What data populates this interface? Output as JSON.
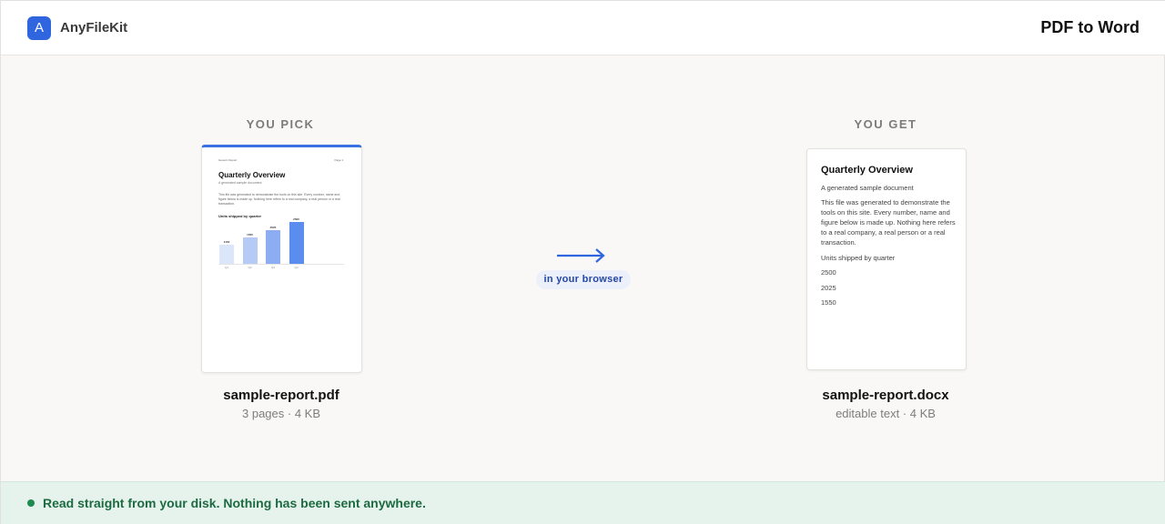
{
  "app": {
    "logo_letter": "A",
    "name": "AnyFileKit",
    "tool_title": "PDF to Word"
  },
  "source": {
    "label": "YOU PICK",
    "file_name": "sample-report.pdf",
    "meta": "3 pages · 4 KB",
    "preview": {
      "header_left": "Generic Report",
      "header_right": "Page 1",
      "title": "Quarterly Overview",
      "subtitle": "A generated sample document",
      "body": "This file was generated to demonstrate the tools on this site. Every number, name and figure below is made up. Nothing here refers to a real company, a real person or a real transaction.",
      "chart_title": "Units shipped by quarter",
      "chart_data": {
        "type": "bar",
        "categories": [
          "Q1",
          "Q2",
          "Q3",
          "Q4"
        ],
        "values": [
          1150,
          1550,
          2025,
          2500
        ]
      }
    }
  },
  "connector": {
    "label": "in your browser"
  },
  "result": {
    "label": "YOU GET",
    "file_name": "sample-report.docx",
    "meta": "editable text · 4 KB",
    "preview": {
      "title": "Quarterly Overview",
      "lines": [
        "A generated sample document",
        "This file was generated to demonstrate the tools on this site. Every number, name and figure below is made up. Nothing here refers to a real company, a real person or a real transaction.",
        "Units shipped by quarter",
        "2500",
        "2025",
        "1550"
      ]
    }
  },
  "footer": {
    "message": "Read straight from your disk. Nothing has been sent anywhere."
  },
  "colors": {
    "accent": "#2f66e0",
    "success": "#1f8a52",
    "bar_colors": [
      "#dce6fb",
      "#b5cbf6",
      "#8cadf2",
      "#5b8def"
    ]
  }
}
